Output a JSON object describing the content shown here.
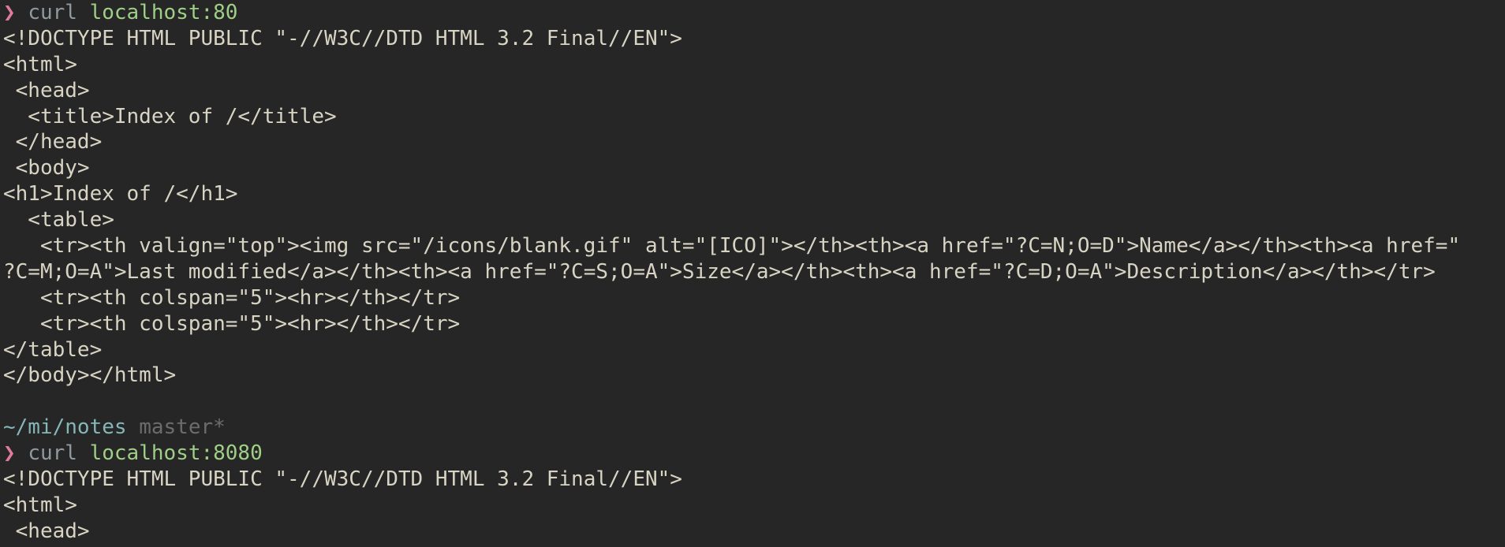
{
  "terminal": {
    "block1": {
      "prompt": {
        "arrow": "❯",
        "command": "curl",
        "argument": "localhost:80"
      },
      "output": [
        "<!DOCTYPE HTML PUBLIC \"-//W3C//DTD HTML 3.2 Final//EN\">",
        "<html>",
        " <head>",
        "  <title>Index of /</title>",
        " </head>",
        " <body>",
        "<h1>Index of /</h1>",
        "  <table>",
        "   <tr><th valign=\"top\"><img src=\"/icons/blank.gif\" alt=\"[ICO]\"></th><th><a href=\"?C=N;O=D\">Name</a></th><th><a href=\"",
        "?C=M;O=A\">Last modified</a></th><th><a href=\"?C=S;O=A\">Size</a></th><th><a href=\"?C=D;O=A\">Description</a></th></tr>",
        "   <tr><th colspan=\"5\"><hr></th></tr>",
        "   <tr><th colspan=\"5\"><hr></th></tr>",
        "</table>",
        "</body></html>"
      ]
    },
    "status": {
      "cwd": "~/mi/notes",
      "branch": "master*"
    },
    "block2": {
      "prompt": {
        "arrow": "❯",
        "command": "curl",
        "argument": "localhost:8080"
      },
      "output": [
        "<!DOCTYPE HTML PUBLIC \"-//W3C//DTD HTML 3.2 Final//EN\">",
        "<html>",
        " <head>"
      ]
    }
  },
  "colors": {
    "background": "#262626",
    "text": "#d8d4c4",
    "prompt_arrow": "#e07aa0",
    "command": "#8e9a9e",
    "argument": "#9fcf86",
    "cwd": "#86b6b8",
    "branch": "#6c6c6c"
  }
}
